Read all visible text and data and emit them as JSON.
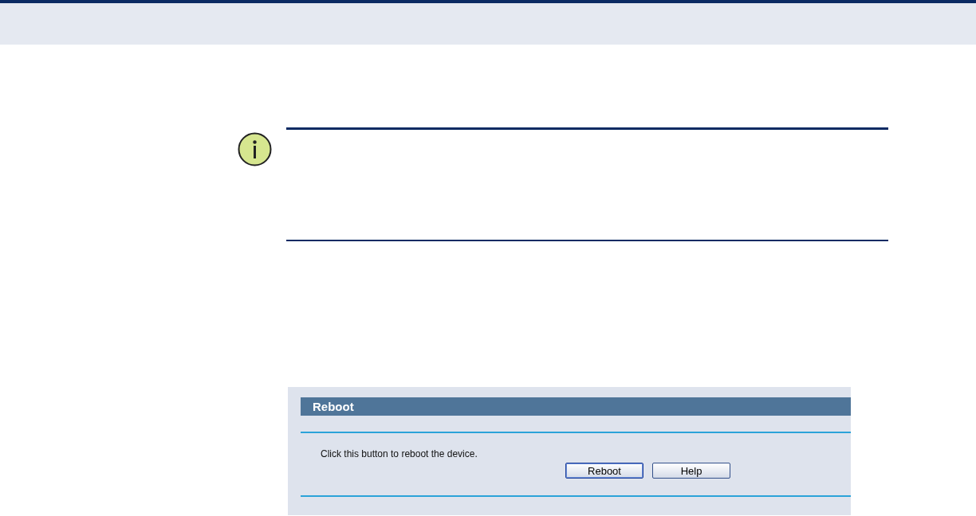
{
  "reboot_panel": {
    "title": "Reboot",
    "description": "Click this button to reboot the device.",
    "buttons": [
      {
        "label": "Reboot",
        "focused": true
      },
      {
        "label": "Help",
        "focused": false
      }
    ]
  }
}
